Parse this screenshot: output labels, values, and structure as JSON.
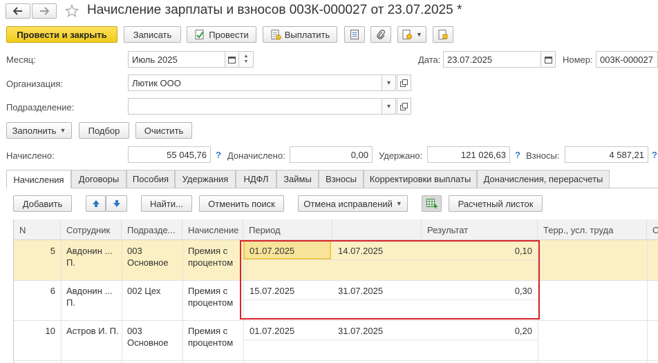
{
  "header": {
    "title": "Начисление зарплаты и взносов 003К-000027 от 23.07.2025 *"
  },
  "toolbar": {
    "post_close": "Провести и закрыть",
    "save": "Записать",
    "post": "Провести",
    "pay": "Выплатить"
  },
  "form": {
    "month_label": "Месяц:",
    "month_value": "Июль 2025",
    "date_label": "Дата:",
    "date_value": "23.07.2025",
    "number_label": "Номер:",
    "number_value": "003К-000027",
    "org_label": "Организация:",
    "org_value": "Лютик ООО",
    "dept_label": "Подразделение:",
    "dept_value": ""
  },
  "actions": {
    "fill": "Заполнить",
    "select": "Подбор",
    "clear": "Очистить"
  },
  "totals": {
    "accrued_label": "Начислено:",
    "accrued_value": "55 045,76",
    "extra_label": "Доначислено:",
    "extra_value": "0,00",
    "withheld_label": "Удержано:",
    "withheld_value": "121 026,63",
    "contrib_label": "Взносы:",
    "contrib_value": "4 587,21",
    "help": "?"
  },
  "tabs": [
    "Начисления",
    "Договоры",
    "Пособия",
    "Удержания",
    "НДФЛ",
    "Займы",
    "Взносы",
    "Корректировки выплаты",
    "Доначисления, перерасчеты"
  ],
  "table_toolbar": {
    "add": "Добавить",
    "find": "Найти...",
    "cancel_search": "Отменить поиск",
    "undo_corrections": "Отмена исправлений",
    "payslip": "Расчетный листок"
  },
  "table": {
    "columns": [
      "N",
      "Сотрудник",
      "Подразде...",
      "Начисление",
      "Период",
      "",
      "Результат",
      "Терр., усл. труда",
      "С"
    ],
    "rows": [
      {
        "n": "5",
        "employee": "Авдонин ... П.",
        "dept": "003 Основное",
        "accrual": "Премия с процентом",
        "from": "01.07.2025",
        "to": "14.07.2025",
        "result": "0,10"
      },
      {
        "n": "6",
        "employee": "Авдонин ... П.",
        "dept": "002 Цех",
        "accrual": "Премия с процентом",
        "from": "15.07.2025",
        "to": "31.07.2025",
        "result": "0,30"
      },
      {
        "n": "10",
        "employee": "Астров И. П.",
        "dept": "003 Основное",
        "accrual": "Премия с процентом",
        "from": "01.07.2025",
        "to": "31.07.2025",
        "result": "0,20"
      }
    ]
  },
  "colors": {
    "primary_button": "#f2cb1b",
    "selected_row": "#fbf0c4",
    "highlight_frame": "#d9232d",
    "help_mark": "#2f79c6"
  }
}
